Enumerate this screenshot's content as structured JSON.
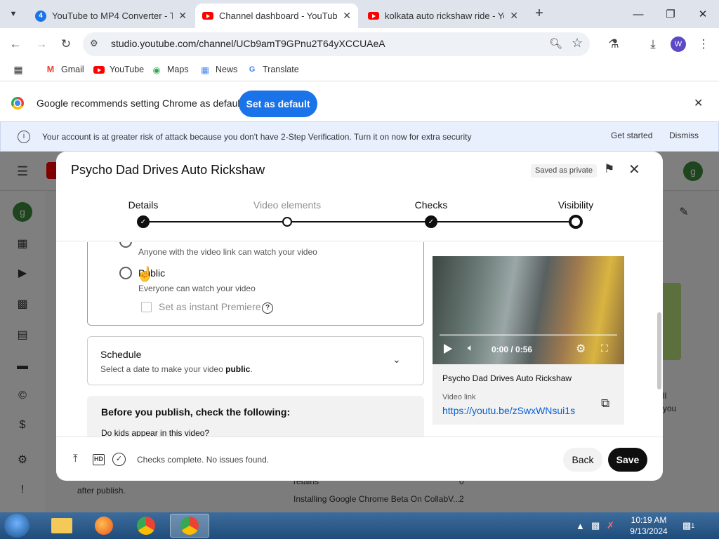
{
  "browser": {
    "tabs": [
      {
        "badge": "4",
        "title": "YouTube to MP4 Converter - Tu",
        "active": false
      },
      {
        "title": "Channel dashboard - YouTube",
        "active": true
      },
      {
        "title": "kolkata auto rickshaw ride - Yo",
        "active": false
      }
    ],
    "url": "studio.youtube.com/channel/UCb9amT9GPnu2T64yXCCUAeA",
    "profile_initial": "W",
    "bookmarks": [
      "Gmail",
      "YouTube",
      "Maps",
      "News",
      "Translate"
    ]
  },
  "default_banner": {
    "text": "Google recommends setting Chrome as default",
    "button": "Set as default"
  },
  "studio": {
    "alert_text": "Your account is at greater risk of attack because you don't have 2-Step Verification. Turn it on now for extra security",
    "get_started": "Get started",
    "dismiss": "Dismiss",
    "avatar_initial": "g",
    "bg_text_1": "after publish.",
    "bg_text_2": "retains",
    "bg_text_3": "Installing Google Chrome Beta On CollabV...",
    "bg_num_2": "0",
    "bg_num_3": "2",
    "bg_right_1": "ll",
    "bg_right_2": "you"
  },
  "modal": {
    "title": "Psycho Dad Drives Auto Rickshaw",
    "saved_status": "Saved as private",
    "steps": [
      {
        "label": "Details",
        "state": "done"
      },
      {
        "label": "Video elements",
        "state": "open"
      },
      {
        "label": "Checks",
        "state": "done"
      },
      {
        "label": "Visibility",
        "state": "current"
      }
    ],
    "unlisted_desc": "Anyone with the video link can watch your video",
    "public_label": "Public",
    "public_desc": "Everyone can watch your video",
    "premiere_label": "Set as instant Premiere",
    "schedule": {
      "title": "Schedule",
      "sub_prefix": "Select a date to make your video ",
      "sub_bold": "public",
      "sub_suffix": "."
    },
    "before_title": "Before you publish, check the following:",
    "before_question": "Do kids appear in this video?",
    "preview": {
      "time": "0:00 / 0:56",
      "video_title": "Psycho Dad Drives Auto Rickshaw",
      "link_label": "Video link",
      "link": "https://youtu.be/zSwxWNsui1s"
    },
    "footer_status": "Checks complete. No issues found.",
    "back": "Back",
    "save": "Save",
    "hd_label": "HD"
  },
  "taskbar": {
    "time": "10:19 AM",
    "date": "9/13/2024",
    "notif_count": "1"
  },
  "colors": {
    "accent_blue": "#1a73e8",
    "youtube_red": "#ff0000",
    "link_blue": "#065fd4"
  }
}
